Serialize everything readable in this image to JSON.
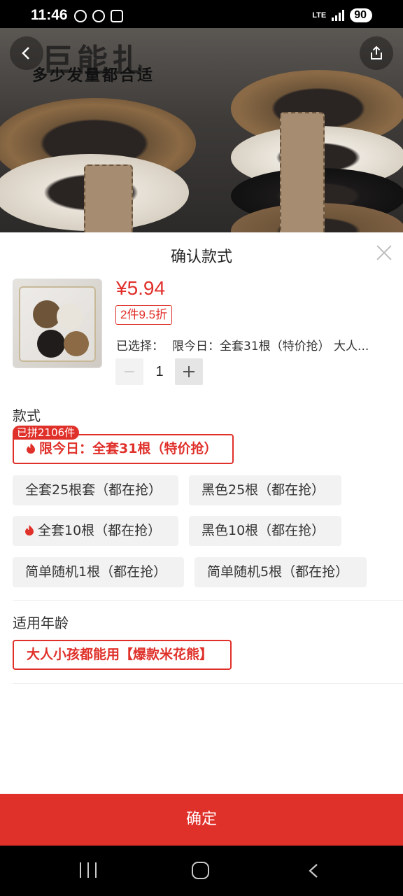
{
  "status_bar": {
    "time": "11:46",
    "network": "LTE",
    "battery": "90"
  },
  "banner": {
    "title": "巨能扎",
    "subtitle": "多少发量都合适"
  },
  "sheet": {
    "title": "确认款式"
  },
  "product": {
    "price": "¥5.94",
    "discount": "2件9.5折",
    "selected_prefix": "已选择：",
    "selected_value": "限今日：全套31根（特价抢） 大人...",
    "quantity": "1"
  },
  "style_section": {
    "label": "款式",
    "sold_badge": "已拼2106件",
    "options": [
      {
        "label": "限今日：全套31根（特价抢）",
        "hot": true,
        "selected": true
      },
      {
        "label": "全套25根套（都在抢）",
        "hot": false,
        "selected": false
      },
      {
        "label": "黑色25根（都在抢）",
        "hot": false,
        "selected": false
      },
      {
        "label": "全套10根（都在抢）",
        "hot": true,
        "selected": false
      },
      {
        "label": "黑色10根（都在抢）",
        "hot": false,
        "selected": false
      },
      {
        "label": "简单随机1根（都在抢）",
        "hot": false,
        "selected": false
      },
      {
        "label": "简单随机5根（都在抢）",
        "hot": false,
        "selected": false
      }
    ]
  },
  "age_section": {
    "label": "适用年龄",
    "options": [
      {
        "label": "大人小孩都能用【爆款米花熊】",
        "selected": true
      }
    ]
  },
  "confirm_label": "确定",
  "colors": {
    "accent": "#e0302a",
    "option_bg": "#f2f2f2"
  },
  "icons": [
    "back-icon",
    "share-icon",
    "close-icon",
    "minus-icon",
    "plus-icon",
    "fire-icon",
    "nav-recent-icon",
    "nav-home-icon",
    "nav-back-icon"
  ]
}
